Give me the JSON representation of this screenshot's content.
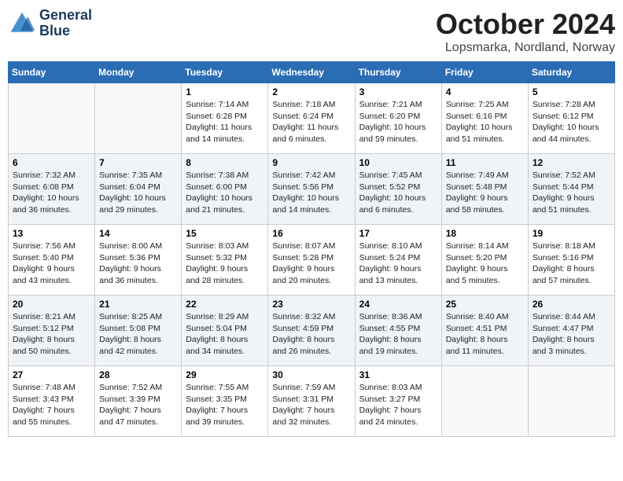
{
  "logo": {
    "line1": "General",
    "line2": "Blue"
  },
  "title": "October 2024",
  "location": "Lopsmarka, Nordland, Norway",
  "days_of_week": [
    "Sunday",
    "Monday",
    "Tuesday",
    "Wednesday",
    "Thursday",
    "Friday",
    "Saturday"
  ],
  "weeks": [
    [
      {
        "day": "",
        "info": ""
      },
      {
        "day": "",
        "info": ""
      },
      {
        "day": "1",
        "info": "Sunrise: 7:14 AM\nSunset: 6:28 PM\nDaylight: 11 hours\nand 14 minutes."
      },
      {
        "day": "2",
        "info": "Sunrise: 7:18 AM\nSunset: 6:24 PM\nDaylight: 11 hours\nand 6 minutes."
      },
      {
        "day": "3",
        "info": "Sunrise: 7:21 AM\nSunset: 6:20 PM\nDaylight: 10 hours\nand 59 minutes."
      },
      {
        "day": "4",
        "info": "Sunrise: 7:25 AM\nSunset: 6:16 PM\nDaylight: 10 hours\nand 51 minutes."
      },
      {
        "day": "5",
        "info": "Sunrise: 7:28 AM\nSunset: 6:12 PM\nDaylight: 10 hours\nand 44 minutes."
      }
    ],
    [
      {
        "day": "6",
        "info": "Sunrise: 7:32 AM\nSunset: 6:08 PM\nDaylight: 10 hours\nand 36 minutes."
      },
      {
        "day": "7",
        "info": "Sunrise: 7:35 AM\nSunset: 6:04 PM\nDaylight: 10 hours\nand 29 minutes."
      },
      {
        "day": "8",
        "info": "Sunrise: 7:38 AM\nSunset: 6:00 PM\nDaylight: 10 hours\nand 21 minutes."
      },
      {
        "day": "9",
        "info": "Sunrise: 7:42 AM\nSunset: 5:56 PM\nDaylight: 10 hours\nand 14 minutes."
      },
      {
        "day": "10",
        "info": "Sunrise: 7:45 AM\nSunset: 5:52 PM\nDaylight: 10 hours\nand 6 minutes."
      },
      {
        "day": "11",
        "info": "Sunrise: 7:49 AM\nSunset: 5:48 PM\nDaylight: 9 hours\nand 58 minutes."
      },
      {
        "day": "12",
        "info": "Sunrise: 7:52 AM\nSunset: 5:44 PM\nDaylight: 9 hours\nand 51 minutes."
      }
    ],
    [
      {
        "day": "13",
        "info": "Sunrise: 7:56 AM\nSunset: 5:40 PM\nDaylight: 9 hours\nand 43 minutes."
      },
      {
        "day": "14",
        "info": "Sunrise: 8:00 AM\nSunset: 5:36 PM\nDaylight: 9 hours\nand 36 minutes."
      },
      {
        "day": "15",
        "info": "Sunrise: 8:03 AM\nSunset: 5:32 PM\nDaylight: 9 hours\nand 28 minutes."
      },
      {
        "day": "16",
        "info": "Sunrise: 8:07 AM\nSunset: 5:28 PM\nDaylight: 9 hours\nand 20 minutes."
      },
      {
        "day": "17",
        "info": "Sunrise: 8:10 AM\nSunset: 5:24 PM\nDaylight: 9 hours\nand 13 minutes."
      },
      {
        "day": "18",
        "info": "Sunrise: 8:14 AM\nSunset: 5:20 PM\nDaylight: 9 hours\nand 5 minutes."
      },
      {
        "day": "19",
        "info": "Sunrise: 8:18 AM\nSunset: 5:16 PM\nDaylight: 8 hours\nand 57 minutes."
      }
    ],
    [
      {
        "day": "20",
        "info": "Sunrise: 8:21 AM\nSunset: 5:12 PM\nDaylight: 8 hours\nand 50 minutes."
      },
      {
        "day": "21",
        "info": "Sunrise: 8:25 AM\nSunset: 5:08 PM\nDaylight: 8 hours\nand 42 minutes."
      },
      {
        "day": "22",
        "info": "Sunrise: 8:29 AM\nSunset: 5:04 PM\nDaylight: 8 hours\nand 34 minutes."
      },
      {
        "day": "23",
        "info": "Sunrise: 8:32 AM\nSunset: 4:59 PM\nDaylight: 8 hours\nand 26 minutes."
      },
      {
        "day": "24",
        "info": "Sunrise: 8:36 AM\nSunset: 4:55 PM\nDaylight: 8 hours\nand 19 minutes."
      },
      {
        "day": "25",
        "info": "Sunrise: 8:40 AM\nSunset: 4:51 PM\nDaylight: 8 hours\nand 11 minutes."
      },
      {
        "day": "26",
        "info": "Sunrise: 8:44 AM\nSunset: 4:47 PM\nDaylight: 8 hours\nand 3 minutes."
      }
    ],
    [
      {
        "day": "27",
        "info": "Sunrise: 7:48 AM\nSunset: 3:43 PM\nDaylight: 7 hours\nand 55 minutes."
      },
      {
        "day": "28",
        "info": "Sunrise: 7:52 AM\nSunset: 3:39 PM\nDaylight: 7 hours\nand 47 minutes."
      },
      {
        "day": "29",
        "info": "Sunrise: 7:55 AM\nSunset: 3:35 PM\nDaylight: 7 hours\nand 39 minutes."
      },
      {
        "day": "30",
        "info": "Sunrise: 7:59 AM\nSunset: 3:31 PM\nDaylight: 7 hours\nand 32 minutes."
      },
      {
        "day": "31",
        "info": "Sunrise: 8:03 AM\nSunset: 3:27 PM\nDaylight: 7 hours\nand 24 minutes."
      },
      {
        "day": "",
        "info": ""
      },
      {
        "day": "",
        "info": ""
      }
    ]
  ]
}
